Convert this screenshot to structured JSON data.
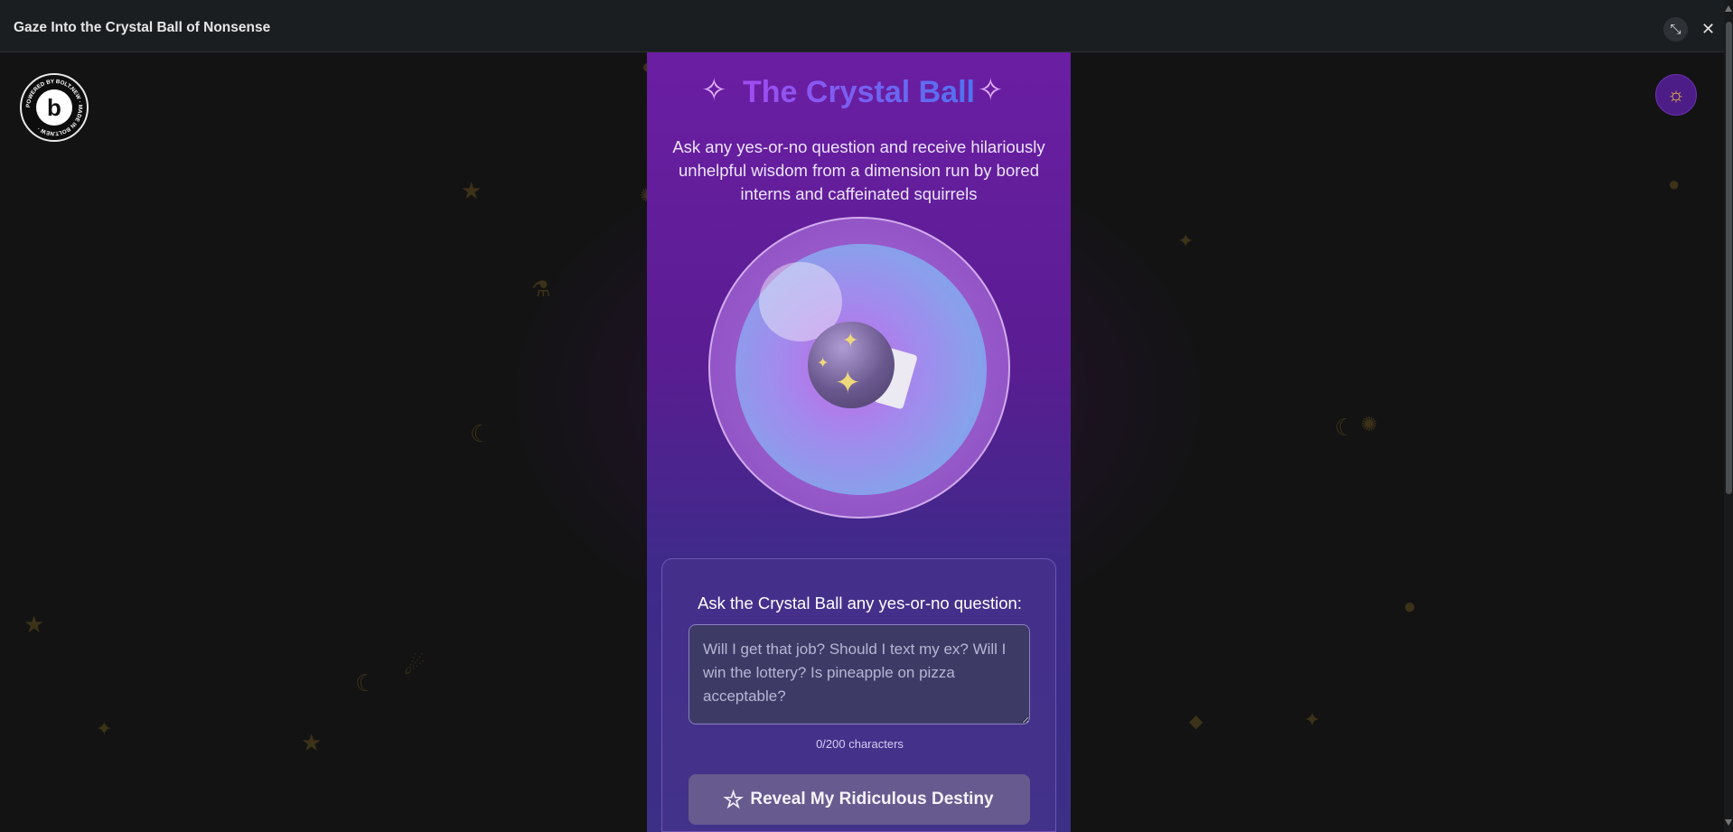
{
  "window": {
    "title": "Gaze Into the Crystal Ball of Nonsense",
    "collapse_icon": "collapse-arrows-icon",
    "close_icon": "close-icon"
  },
  "badge": {
    "letter": "b",
    "ring_text": "POWERED BY BOLT.NEW · MADE IN BOLT.NEW ·"
  },
  "theme_toggle": {
    "icon": "sun-icon"
  },
  "header": {
    "title": "The Crystal Ball",
    "subtitle": "Ask any yes-or-no question and receive hilariously unhelpful wisdom from a dimension run by bored interns and caffeinated squirrels"
  },
  "form": {
    "label": "Ask the Crystal Ball any yes-or-no question:",
    "placeholder": "Will I get that job? Should I text my ex? Will I win the lottery? Is pineapple on pizza acceptable?",
    "value": "",
    "char_count": "0/200 characters",
    "submit_label": "Reveal My Ridiculous Destiny",
    "submit_icon": "star-outline-icon"
  },
  "colors": {
    "accent": "#7c3aed",
    "title_gradient_start": "#a04cf0",
    "title_gradient_end": "#4f74f0",
    "panel": "#6b1ea3"
  }
}
